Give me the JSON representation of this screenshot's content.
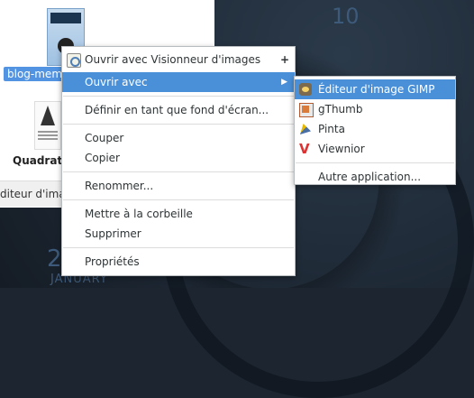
{
  "desktop": {
    "wallpaper_text_top": "10",
    "wallpaper_day": "2",
    "wallpaper_month": "JANUARY"
  },
  "file_manager": {
    "file1_label": "blog-meme",
    "file2_label": "Quadratu",
    "statusbar_text": "diteur d'image"
  },
  "context_menu": {
    "items": [
      {
        "label": "Ouvrir avec Visionneur d'images",
        "icon": "image-viewer-icon"
      },
      {
        "label": "Ouvrir avec"
      },
      {
        "label": "Définir en tant que fond d'écran..."
      },
      {
        "label": "Couper"
      },
      {
        "label": "Copier"
      },
      {
        "label": "Renommer..."
      },
      {
        "label": "Mettre à la corbeille"
      },
      {
        "label": "Supprimer"
      },
      {
        "label": "Propriétés"
      }
    ],
    "plus_symbol": "+",
    "submenu_arrow": "▶"
  },
  "submenu": {
    "items": [
      {
        "label": "Éditeur d'image GIMP",
        "icon": "gimp-icon"
      },
      {
        "label": "gThumb",
        "icon": "gthumb-icon"
      },
      {
        "label": "Pinta",
        "icon": "pinta-icon"
      },
      {
        "label": "Viewnior",
        "icon": "viewnior-icon",
        "glyph": "V"
      },
      {
        "label": "Autre application..."
      }
    ]
  },
  "colors": {
    "highlight": "#4a90d9",
    "selection": "#5294e2",
    "menu_background": "#ffffff"
  }
}
